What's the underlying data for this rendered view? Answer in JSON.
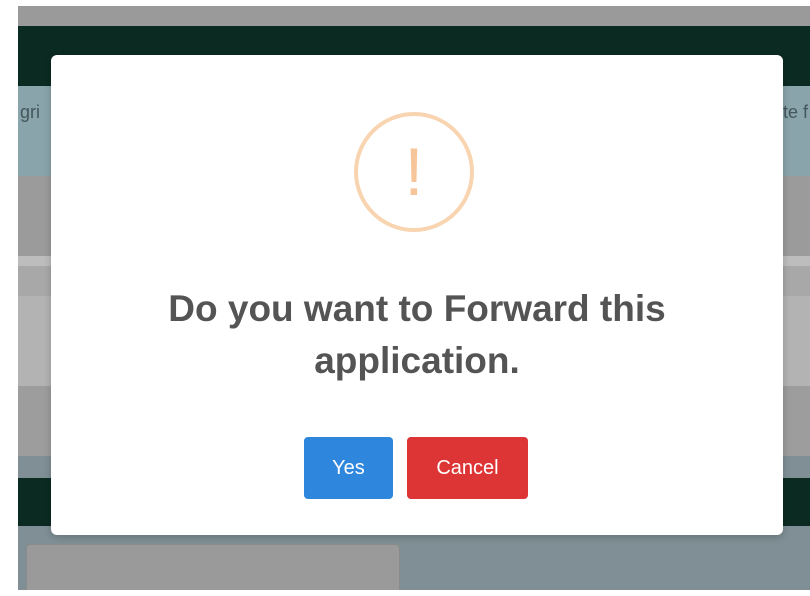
{
  "background": {
    "header_left_text": "gri",
    "header_right_text": "te f"
  },
  "dialog": {
    "icon": "exclamation-warning-icon",
    "icon_glyph": "!",
    "title": "Do you want to Forward this application.",
    "confirm_label": "Yes",
    "cancel_label": "Cancel"
  },
  "colors": {
    "confirm_button": "#2f86dd",
    "cancel_button": "#dd3535",
    "warning_icon": "#f7c59a",
    "navbar": "#0b2a22"
  }
}
